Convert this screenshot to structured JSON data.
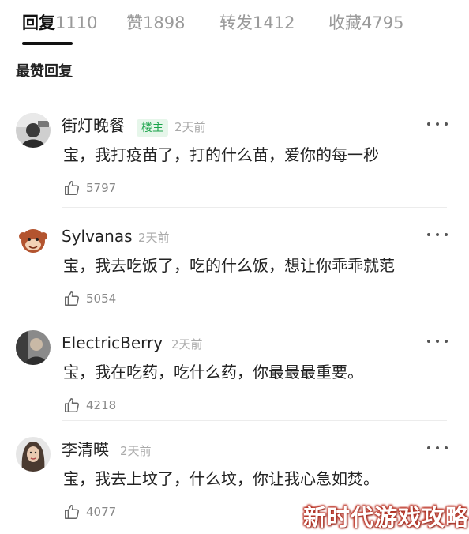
{
  "tabs": [
    {
      "label": "回复",
      "count": "1110"
    },
    {
      "label": "赞",
      "count": "1898"
    },
    {
      "label": "转发",
      "count": "1412"
    },
    {
      "label": "收藏",
      "count": "4795"
    }
  ],
  "section_title": "最赞回复",
  "comments": [
    {
      "name": "街灯晚餐",
      "badge": "楼主",
      "time": "2天前",
      "text": "宝，我打疫苗了，打的什么苗，爱你的每一秒",
      "likes": "5797"
    },
    {
      "name": "Sylvanas",
      "badge": "",
      "time": "2天前",
      "text": "宝，我去吃饭了，吃的什么饭，想让你乖乖就范",
      "likes": "5054"
    },
    {
      "name": "ElectricBerry",
      "badge": "",
      "time": "2天前",
      "text": "宝，我在吃药，吃什么药，你最最最重要。",
      "likes": "4218"
    },
    {
      "name": "李清暎",
      "badge": "",
      "time": "2天前",
      "text": "宝，我去上坟了，什么坟，你让我心急如焚。",
      "likes": "4077"
    }
  ],
  "watermark": "新时代游戏攻略",
  "colors": {
    "accent_green": "#1aa34a",
    "tab_active": "#111111",
    "muted": "#9a9a9a"
  }
}
